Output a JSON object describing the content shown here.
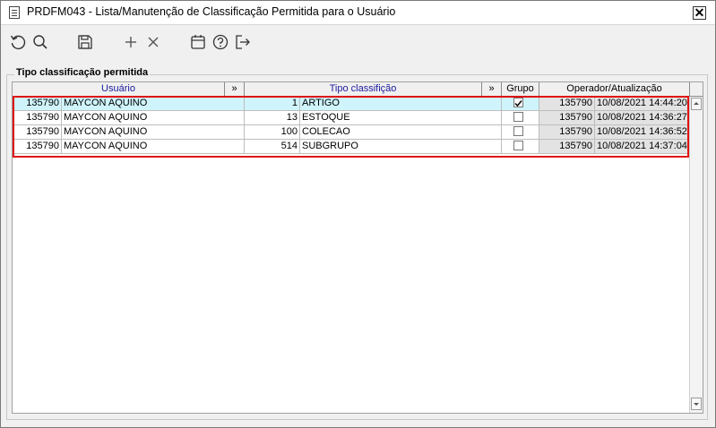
{
  "window": {
    "title": "PRDFM043 - Lista/Manutenção de Classificação Permitida para o Usuário",
    "close_label": "✕"
  },
  "toolbar": {
    "icons": [
      "refresh-icon",
      "search-icon",
      "save-icon",
      "add-icon",
      "delete-icon",
      "calendar-icon",
      "help-icon",
      "exit-icon"
    ]
  },
  "group": {
    "label": "Tipo classificação permitida"
  },
  "grid": {
    "headers": {
      "usuario": "Usuário",
      "expand1": "»",
      "tipo": "Tipo classifição",
      "expand2": "»",
      "grupo": "Grupo",
      "operador": "Operador/Atualização"
    },
    "rows": [
      {
        "user_id": "135790",
        "user_name": "MAYCON AQUINO",
        "tipo_id": "1",
        "tipo_name": "ARTIGO",
        "grupo": true,
        "op_id": "135790",
        "updated": "10/08/2021 14:44:20"
      },
      {
        "user_id": "135790",
        "user_name": "MAYCON AQUINO",
        "tipo_id": "13",
        "tipo_name": "ESTOQUE",
        "grupo": false,
        "op_id": "135790",
        "updated": "10/08/2021 14:36:27"
      },
      {
        "user_id": "135790",
        "user_name": "MAYCON AQUINO",
        "tipo_id": "100",
        "tipo_name": "COLECAO",
        "grupo": false,
        "op_id": "135790",
        "updated": "10/08/2021 14:36:52"
      },
      {
        "user_id": "135790",
        "user_name": "MAYCON AQUINO",
        "tipo_id": "514",
        "tipo_name": "SUBGRUPO",
        "grupo": false,
        "op_id": "135790",
        "updated": "10/08/2021 14:37:04"
      }
    ]
  },
  "colors": {
    "selected_row": "#cff4fc",
    "highlight": "#e01010",
    "header_text": "#1a1aa0"
  }
}
